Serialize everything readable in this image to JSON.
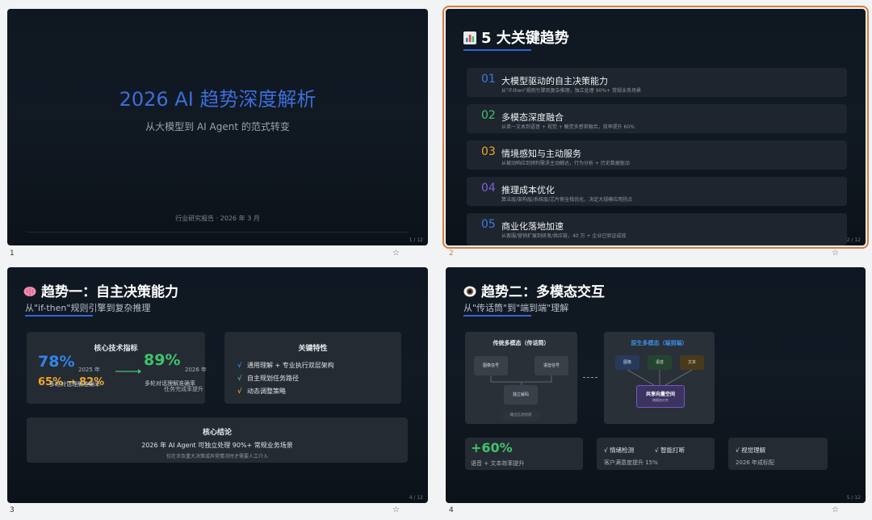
{
  "slides": [
    {
      "thumb_number": "1",
      "page": "1 / 12",
      "title": "2026 AI 趋势深度解析",
      "subtitle": "从大模型到 AI Agent 的范式转变",
      "meta": "行业研究报告 · 2026 年 3 月"
    },
    {
      "thumb_number": "2",
      "page": "2 / 12",
      "title": "5 大关键趋势",
      "trends": [
        {
          "num": "01",
          "title": "大模型驱动的自主决策能力",
          "desc": "从\"if-then\"规则引擎到复杂推理，独立处理 90%+ 常规业务场景",
          "color": "#3a7be0"
        },
        {
          "num": "02",
          "title": "多模态深度融合",
          "desc": "从单一文本到语音 + 视觉 + 触觉多感官融合，效率提升 60%",
          "color": "#3ec46d"
        },
        {
          "num": "03",
          "title": "情境感知与主动服务",
          "desc": "从被动响应到预判需求主动触达，行为分析 + 历史数据驱动",
          "color": "#f0a623"
        },
        {
          "num": "04",
          "title": "推理成本优化",
          "desc": "算法层/架构层/系统层/芯片侧全栈优化，决定大规模应用拐点",
          "color": "#7c63d8"
        },
        {
          "num": "05",
          "title": "商业化落地加速",
          "desc": "从客服/营销扩展到研发/供应链，40 万 + 企业已验证成效",
          "color": "#3a7be0"
        }
      ]
    },
    {
      "thumb_number": "3",
      "page": "4 / 12",
      "title": "趋势一：自主决策能力",
      "subtitle": "从\"if-then\"规则引擎到复杂推理",
      "metrics_card": {
        "title": "核心技术指标",
        "value_a": "78%",
        "value_b": "65% → 82%",
        "year_a": "2025 年",
        "label_a": "多轮对话理解准确率",
        "value_c": "89%",
        "year_c": "2026 年",
        "label_c": "多轮对话理解准确率",
        "label_d": "任务完成率提升"
      },
      "features_card": {
        "title": "关键特性",
        "items": [
          {
            "mark": "√",
            "text": "通用理解 + 专业执行双层架构",
            "color": "#3a8ee6"
          },
          {
            "mark": "√",
            "text": "自主规划任务路径",
            "color": "#3ec46d"
          },
          {
            "mark": "√",
            "text": "动态调整策略",
            "color": "#f0a623"
          }
        ]
      },
      "conclusion_card": {
        "title": "核心结论",
        "text": "2026 年 AI Agent 可独立处理 90%+ 常规业务场景",
        "note": "仅在涉及重大决策或异常情况时才需要人工介入"
      }
    },
    {
      "thumb_number": "4",
      "page": "5 / 12",
      "title": "趋势二：多模态交互",
      "subtitle": "从\"传话筒\"到\"端到端\"理解",
      "traditional": {
        "title": "传统多模态（传话筒）",
        "box_image": "图像信号",
        "box_audio": "语音信号",
        "box_decode": "独立解码",
        "box_output": "输出信息损耗"
      },
      "native": {
        "title": "原生多模态（端到端）",
        "box_image": "图像",
        "box_audio": "语音",
        "box_text": "文本",
        "box_shared": "共享向量空间",
        "box_shared_sub": "跨模态对齐"
      },
      "stats": [
        {
          "big": "+60%",
          "small": "语音 + 文本效率提升"
        },
        {
          "line1": "√ 情绪检测",
          "line2": "√ 智能打断",
          "small": "客户满意度提升 15%"
        },
        {
          "line1": "√ 视觉理解",
          "small": "2026 年成标配"
        }
      ]
    }
  ],
  "colors": {
    "accent_blue": "#3564d6",
    "selection": "#d97a3c",
    "green": "#3ec46d",
    "orange": "#f0a623"
  }
}
